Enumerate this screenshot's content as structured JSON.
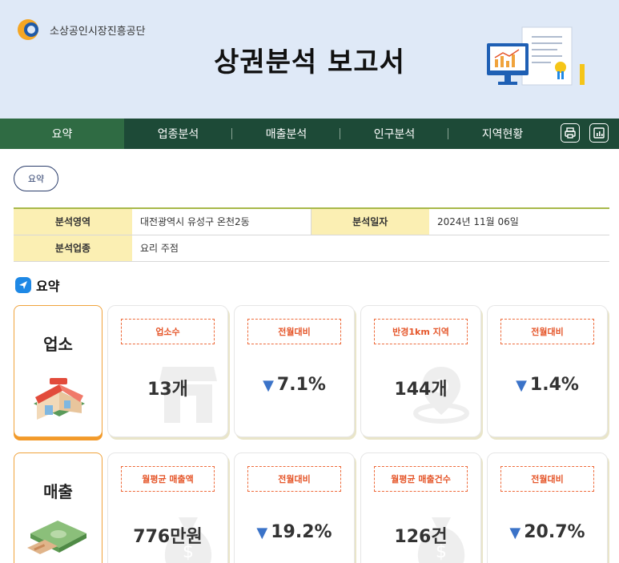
{
  "header": {
    "org_name": "소상공인시장진흥공단",
    "title": "상권분석 보고서"
  },
  "nav": {
    "tabs": [
      {
        "label": "요약",
        "active": true
      },
      {
        "label": "업종분석",
        "active": false
      },
      {
        "label": "매출분석",
        "active": false
      },
      {
        "label": "인구분석",
        "active": false
      },
      {
        "label": "지역현황",
        "active": false
      }
    ],
    "icons": [
      "print-icon",
      "chart-report-icon"
    ]
  },
  "pill": {
    "label": "요약"
  },
  "info": {
    "area_label": "분석영역",
    "area_value": "대전광역시 유성구 온천2동",
    "date_label": "분석일자",
    "date_value": "2024년 11월 06일",
    "industry_label": "분석업종",
    "industry_value": "요리 주점"
  },
  "summary": {
    "title": "요약",
    "rows": [
      {
        "label": "업소",
        "cards": [
          {
            "tag": "업소수",
            "value": "13개",
            "down": false
          },
          {
            "tag": "전월대비",
            "value": "7.1%",
            "down": true
          },
          {
            "tag": "반경1km 지역",
            "value": "144개",
            "down": false
          },
          {
            "tag": "전월대비",
            "value": "1.4%",
            "down": true
          }
        ]
      },
      {
        "label": "매출",
        "cards": [
          {
            "tag": "월평균 매출액",
            "value": "776만원",
            "down": false
          },
          {
            "tag": "전월대비",
            "value": "19.2%",
            "down": true
          },
          {
            "tag": "월평균 매출건수",
            "value": "126건",
            "down": false
          },
          {
            "tag": "전월대비",
            "value": "20.7%",
            "down": true
          }
        ]
      }
    ]
  },
  "colors": {
    "header_bg": "#dfe9f7",
    "nav_bg": "#1d4a37",
    "nav_active": "#2f6b43",
    "accent_orange": "#f0a33c",
    "tag_red": "#e5562a",
    "arrow_blue": "#3b73c8",
    "label_yellow": "#fbefb3"
  }
}
